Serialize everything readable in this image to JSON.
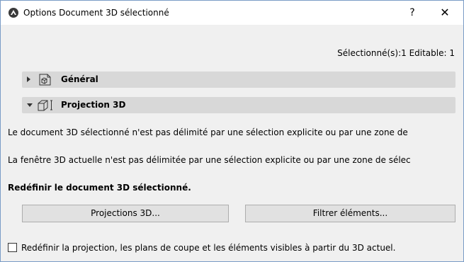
{
  "window": {
    "title": "Options Document 3D sélectionné",
    "help_label": "?",
    "close_label": "✕"
  },
  "selection_info": "Sélectionné(s):1 Editable: 1",
  "sections": [
    {
      "label": "Général",
      "expanded": false,
      "icon": "document-3d-icon"
    },
    {
      "label": "Projection 3D",
      "expanded": true,
      "icon": "projection-3d-icon"
    }
  ],
  "body": {
    "line1": "Le document 3D sélectionné n'est pas délimité par une sélection explicite ou par une zone de",
    "line2": "La fenêtre 3D actuelle n'est pas délimitée par une sélection explicite ou par une zone de sélec",
    "heading": "Redéfinir le document 3D sélectionné."
  },
  "buttons": {
    "projections": "Projections 3D...",
    "filter": "Filtrer éléments..."
  },
  "checkbox": {
    "label": "Redéfinir la projection, les plans de coupe et les éléments visibles à partir du 3D actuel.",
    "checked": false
  }
}
